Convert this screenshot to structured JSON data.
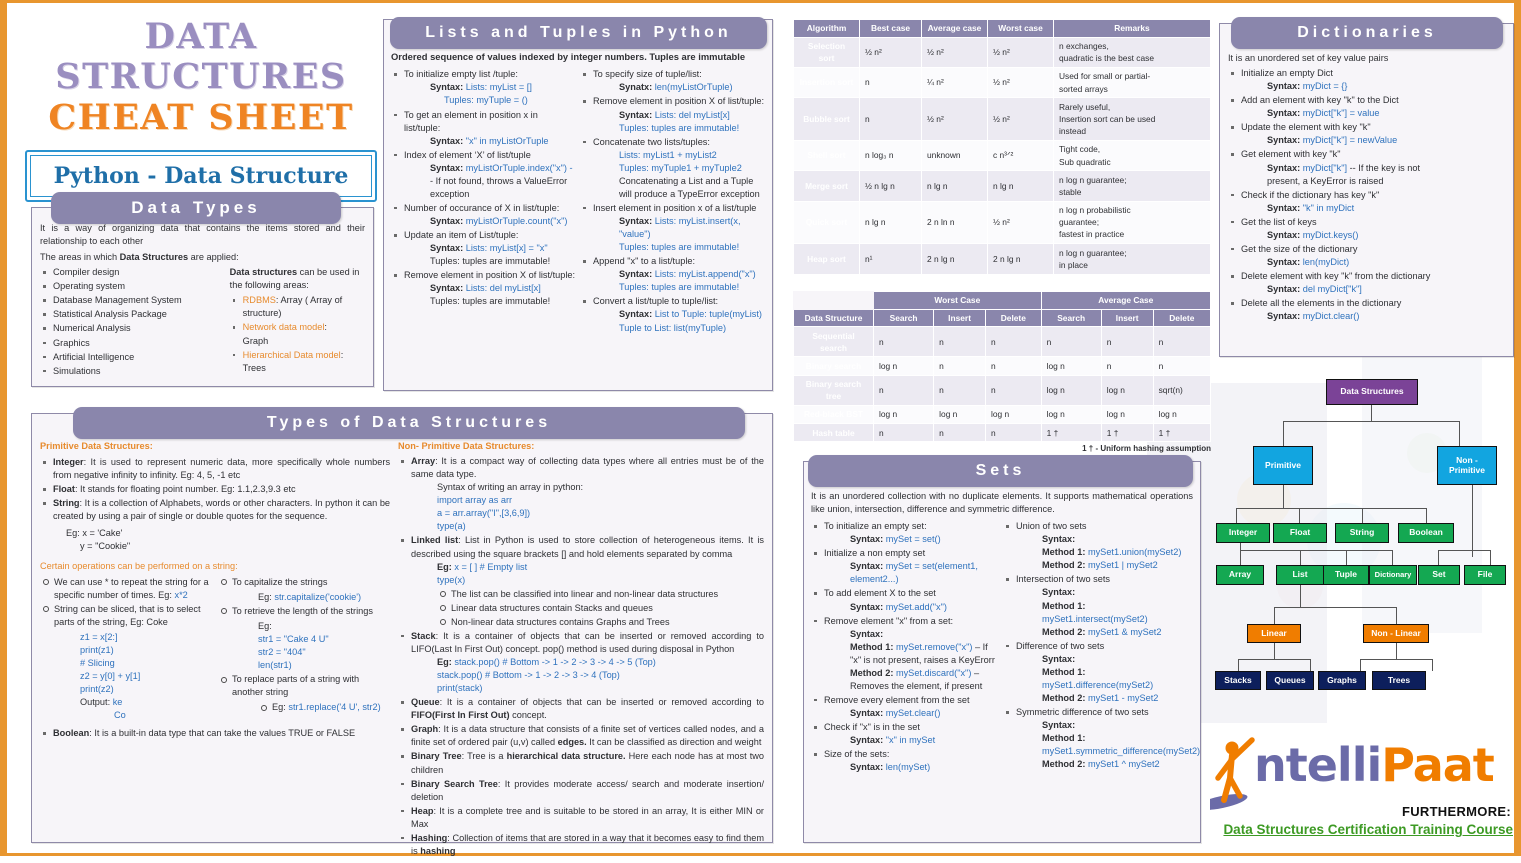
{
  "title": {
    "line1": "DATA STRUCTURES",
    "line2": "CHEAT SHEET",
    "subtitle": "Python - Data Structure"
  },
  "data_types": {
    "heading": "Data Types",
    "intro1": "It is a way of organizing data that contains the items stored and their relationship to each other",
    "intro2_plain": "The areas in which ",
    "intro2_bold": "Data Structures",
    "intro2_tail": " are applied:",
    "areas": [
      "Compiler design",
      "Operating system",
      "Database Management System",
      "Statistical Analysis Package",
      "Numerical Analysis",
      "Graphics",
      "Artificial Intelligence",
      "Simulations"
    ],
    "right_heading_bold": "Data structures",
    "right_heading_tail": " can be used in the following areas:",
    "uses": [
      {
        "label": "RDBMS",
        "text": ": Array ( Array of structure)"
      },
      {
        "label": "Network data model",
        "text": ":",
        "second": "Graph"
      },
      {
        "label": "Hierarchical Data model",
        "text": ":",
        "second": "Trees"
      }
    ]
  },
  "lists_tuples": {
    "heading": "Lists and Tuples in Python",
    "intro": "Ordered sequence of values indexed by integer numbers. Tuples are immutable",
    "left": [
      {
        "t": "To initialize empty list /tuple:",
        "lines": [
          {
            "label": "Syntax: ",
            "code": "Lists: myList = []"
          },
          {
            "label": "",
            "code": "Tuples: myTuple = ()",
            "extraIndent": true
          }
        ]
      },
      {
        "t": "To get an element in position x in list/tuple:",
        "lines": [
          {
            "label": "Syntax: ",
            "code": "\"x\" in myListOrTuple"
          }
        ]
      },
      {
        "t": "Index of element ‘X’ of list/tuple",
        "lines": [
          {
            "label": "Syntax: ",
            "code": "myListOrTuple.index(\"x\") -"
          },
          {
            "label": "",
            "plain": "- If not found, throws a ValueError exception"
          }
        ]
      },
      {
        "t": "Number of occurance of X in list/tuple:",
        "lines": [
          {
            "label": "Syntax: ",
            "code": "myListOrTuple.count(\"x\")"
          }
        ]
      },
      {
        "t": "Update an item of List/tuple:",
        "lines": [
          {
            "label": "Syntax: ",
            "code": "Lists: myList[x] = \"x\""
          },
          {
            "label": "",
            "plain": "Tuples: tuples are immutable!"
          }
        ]
      },
      {
        "t": "Remove element in position X of list/tuple:",
        "lines": [
          {
            "label": "Syntax: ",
            "code": "Lists: del myList[x]"
          },
          {
            "label": "",
            "plain": "Tuples: tuples are immutable!"
          }
        ]
      }
    ],
    "right": [
      {
        "t": "To specify size of tuple/list:",
        "lines": [
          {
            "label": "Synatx: ",
            "code": "len(myListOrTuple)"
          }
        ]
      },
      {
        "t": "Remove element in position X of list/tuple:",
        "lines": [
          {
            "label": "Syntax: ",
            "code": "Lists: del myList[x]"
          },
          {
            "label": "",
            "code": "Tuples: tuples are immutable!"
          }
        ]
      },
      {
        "t": "Concatenate two lists/tuples:",
        "lines": [
          {
            "label": "",
            "code": "Lists: myList1 + myList2"
          },
          {
            "label": "",
            "code": "Tuples: myTuple1 + myTuple2"
          },
          {
            "label": "",
            "plain": "Concatenating a List and a Tuple will produce a TypeError exception"
          }
        ]
      },
      {
        "t": "Insert element in position x of a list/tuple",
        "lines": [
          {
            "label": "Syntax: ",
            "code": "Lists: myList.insert(x, \"value\")"
          },
          {
            "label": "",
            "code": "Tuples: tuples are immutable!"
          }
        ]
      },
      {
        "t": "Append \"x\" to a list/tuple:",
        "lines": [
          {
            "label": "Syntax: ",
            "code": "Lists: myList.append(\"x\")"
          },
          {
            "label": "",
            "code": "Tuples: tuples are immutable!"
          }
        ]
      },
      {
        "t": "Convert a list/tuple to tuple/list:",
        "lines": [
          {
            "label": "Syntax: ",
            "code": "List to Tuple: tuple(myList)"
          },
          {
            "label": "",
            "code": "Tuple to List: list(myTuple)"
          }
        ]
      }
    ]
  },
  "sort_table": {
    "headers": [
      "Algorithm",
      "Best case",
      "Average case",
      "Worst case",
      "Remarks"
    ],
    "rows": [
      {
        "name": "Selection sort",
        "best": "½ n²",
        "avg": "½ n²",
        "worst": "½ n²",
        "remarks": [
          "n exchanges,",
          "quadratic is the best case"
        ]
      },
      {
        "name": "Insertion sort",
        "best": "n",
        "avg": "¼ n²",
        "worst": "½ n²",
        "remarks": [
          "Used for small or partial-",
          "sorted arrays"
        ]
      },
      {
        "name": "Bubble sort",
        "best": "n",
        "avg": "½ n²",
        "worst": "½ n²",
        "remarks": [
          "Rarely useful,",
          "Insertion sort can be used",
          "instead"
        ]
      },
      {
        "name": "Shell sort",
        "best": "n log₃ n",
        "avg": "unknown",
        "worst": "c n³ᐟ²",
        "remarks": [
          "Tight code,",
          "Sub quadratic"
        ]
      },
      {
        "name": "Merge sort",
        "best": "½ n lg n",
        "avg": "n lg n",
        "worst": "n lg n",
        "remarks": [
          "n log n guarantee;",
          "stable"
        ]
      },
      {
        "name": "Quick sort",
        "best": "n lg n",
        "avg": "2 n ln n",
        "worst": "½ n²",
        "remarks": [
          "n log n probabilistic",
          "guarantee;",
          "fastest in practice"
        ]
      },
      {
        "name": "Heap sort",
        "best": "n¹",
        "avg": "2 n lg n",
        "worst": "2 n lg n",
        "remarks": [
          "n log n guarantee;",
          "in place"
        ]
      }
    ]
  },
  "search_table": {
    "group_blank": "",
    "group_worst": "Worst Case",
    "group_average": "Average Case",
    "col_ds": "Data Structure",
    "subheaders": [
      "Search",
      "Insert",
      "Delete",
      "Search",
      "Insert",
      "Delete"
    ],
    "rows": [
      {
        "name": "Sequential search",
        "cells": [
          "n",
          "n",
          "n",
          "n",
          "n",
          "n"
        ]
      },
      {
        "name": "Binary search",
        "cells": [
          "log n",
          "n",
          "n",
          "log n",
          "n",
          "n"
        ]
      },
      {
        "name": "Binary search tree",
        "cells": [
          "n",
          "n",
          "n",
          "log n",
          "log n",
          "sqrt(n)"
        ]
      },
      {
        "name": "Red-black BST",
        "cells": [
          "log n",
          "log n",
          "log n",
          "log n",
          "log n",
          "log n"
        ]
      },
      {
        "name": "Hash table",
        "cells": [
          "n",
          "n",
          "n",
          "1 †",
          "1 †",
          "1 †"
        ]
      }
    ],
    "note": "1 † - Uniform hashing assumption"
  },
  "dictionaries": {
    "heading": "Dictionaries",
    "intro": "It is an unordered set of key value pairs",
    "items": [
      {
        "t": "Initialize an empty Dict",
        "lines": [
          {
            "label": "Syntax: ",
            "code": "myDict = {}"
          }
        ]
      },
      {
        "t": "Add an element with key \"k\" to the Dict",
        "lines": [
          {
            "label": "Syntax: ",
            "code": "myDict[\"k\"] = value"
          }
        ]
      },
      {
        "t": "Update the element with key \"k\"",
        "lines": [
          {
            "label": "Syntax: ",
            "code": "myDict[\"k\"] = newValue"
          }
        ]
      },
      {
        "t": "Get element with key \"k\"",
        "lines": [
          {
            "label": "Syntax: ",
            "code": "myDict[\"k\"]",
            "plainTail": " -- If the key is not"
          },
          {
            "label": "",
            "plain": "present, a KeyError is raised",
            "noIndentExtra": true
          }
        ]
      },
      {
        "t": "Check if the dictionary has key \"k\"",
        "lines": [
          {
            "label": "Syntax: ",
            "code": "\"k\" in myDict"
          }
        ]
      },
      {
        "t": "Get the list of keys",
        "lines": [
          {
            "label": "Syntax: ",
            "code": "myDict.keys()"
          }
        ]
      },
      {
        "t": "Get the size of the dictionary",
        "lines": [
          {
            "label": "Syntax: ",
            "code": "len(myDict)"
          }
        ]
      },
      {
        "t": "Delete element with key \"k\" from the dictionary",
        "lines": [
          {
            "label": "Syntax: ",
            "code": "del myDict[\"k\"]"
          }
        ]
      },
      {
        "t": "Delete all the elements in the dictionary",
        "lines": [
          {
            "label": "Syntax: ",
            "code": "myDict.clear()"
          }
        ]
      }
    ]
  },
  "types_ds": {
    "heading": "Types of Data Structures",
    "primitive_heading": "Primitive Data Structures:",
    "primitive": [
      {
        "label": "Integer",
        "text": ": It is used to represent numeric data, more specifically whole numbers from negative infinity to infinity. Eg: 4, 5, -1 etc"
      },
      {
        "label": "Float",
        "text": ": It stands for floating point number. Eg: 1.1,2.3,9.3 etc"
      },
      {
        "label": "String",
        "text": ": It is a collection of Alphabets, words or other characters. In python it can be created by using a pair of single or double quotes for the sequence."
      }
    ],
    "string_eg": [
      "Eg:  x = 'Cake'",
      "y = \"Cookie\""
    ],
    "ops_heading": "Certain operations can be performed on a string:",
    "ops_left": [
      {
        "t": "We can use * to repeat the string for a specific number of times. Eg: ",
        "code": "x*2"
      },
      {
        "t": "String can be sliced, that is to select parts of the string, Eg: Coke",
        "codeblock": [
          "z1 = x[2:]",
          "print(z1)",
          "# Slicing",
          "z2 = y[0] + y[1]",
          "print(z2)"
        ],
        "output_label": "Output: ",
        "output_code": "ke",
        "output_code2": "Co"
      }
    ],
    "ops_right": [
      {
        "t": "To capitalize the strings",
        "eg_label": "Eg: ",
        "eg_code": "str.capitalize('cookie')"
      },
      {
        "t": "To retrieve the length of the strings",
        "eg_label": "Eg:",
        "codeblock": [
          "str1 = \"Cake 4 U\"",
          "str2 = \"404\"",
          "len(str1)"
        ]
      },
      {
        "t": "To replace parts of a string with another string",
        "sub_eg_label": "Eg: ",
        "sub_eg_code": "str1.replace('4 U', str2)"
      }
    ],
    "boolean": {
      "label": "Boolean",
      "text": ": It is a built-in data type that can take the values TRUE or FALSE"
    },
    "nonprimitive_heading": "Non- Primitive Data Structures:",
    "nonprimitive": [
      {
        "label": "Array",
        "text": ": It is a compact way of collecting data types where all entries must be of the same data type.",
        "sub": [
          "Syntax of writing an array in python:"
        ],
        "codeblock": [
          "import array as arr",
          "a = arr.array(\"I\",[3,6,9])",
          "type(a)"
        ]
      },
      {
        "label": "Linked list",
        "text": ": List in Python is used to store collection of heterogeneous items. It is described using the square brackets [] and hold elements separated by comma",
        "eg_label": "Eg: ",
        "eg_code": "x = [ ] # Empty list",
        "codeblock": [
          "type(x)"
        ],
        "bullets": [
          "The list can be classified into linear and non-linear data structures",
          "Linear data structures contain Stacks and queues",
          "Non-linear data structures contains Graphs and Trees"
        ]
      },
      {
        "label": "Stack",
        "text": ": It is a container of objects that can be inserted or removed according to LIFO(Last In First Out) concept. pop() method is used during disposal in Python",
        "eg_label": "Eg: ",
        "eg_code": "stack.pop() # Bottom -> 1 -> 2 -> 3 -> 4 -> 5 (Top)",
        "codeblock": [
          "stack.pop() # Bottom -> 1 -> 2 -> 3 -> 4 (Top)",
          "print(stack)"
        ]
      },
      {
        "label": "Queue",
        "text": ": It is a container of objects that can be inserted or removed according to ",
        "bold_mid": "FIFO(First In First Out)",
        "tail": " concept."
      },
      {
        "label": "Graph",
        "text": ": It is a data structure that consists of a finite set of vertices called nodes, and a finite set of ordered pair (u,v) called ",
        "bold_mid": "edges.",
        "tail": " It can be classified as direction and weight"
      },
      {
        "label": "Binary Tree",
        "text": ": Tree is a ",
        "bold_mid": "hierarchical data structure.",
        "tail": " Here each node has at most two children"
      },
      {
        "label": "Binary Search Tree",
        "text": ": It provides moderate access/ search and moderate insertion/ deletion"
      },
      {
        "label": "Heap",
        "text": ": It is a complete tree and is suitable to be stored in an array, It is either MIN or Max"
      },
      {
        "label": "Hashing",
        "text": ": Collection of items that are stored in a way that it becomes easy to find them is ",
        "bold_mid": "hashing"
      }
    ]
  },
  "sets": {
    "heading": "Sets",
    "intro": "It is an unordered collection with no duplicate elements. It supports mathematical operations like union, intersection, difference and symmetric difference.",
    "left": [
      {
        "t": "To initialize an empty set:",
        "lines": [
          {
            "label": "Syntax: ",
            "code": "mySet = set()"
          }
        ]
      },
      {
        "t": "Initialize a non empty set",
        "lines": [
          {
            "label": "Syntax:  ",
            "code": "mySet  =  set(element1, element2...)"
          }
        ]
      },
      {
        "t": "To add element X to the set",
        "lines": [
          {
            "label": "Syntax: ",
            "code": "mySet.add(\"x\")"
          }
        ]
      },
      {
        "t": "Remove element \"x\" from a set:",
        "lines": [
          {
            "label": "Syntax:",
            "plain": ""
          },
          {
            "label": "Method 1: ",
            "code": "mySet.remove(\"x\")",
            "plainTail": " – If \"x\" is not present, raises a KeyErorr"
          },
          {
            "label": "Method 2: ",
            "code": "mySet.discard(\"x\")",
            "plainTail": " – Removes the element, if present"
          }
        ]
      },
      {
        "t": "Remove every element from the set",
        "lines": [
          {
            "label": "Syntax: ",
            "code": "mySet.clear()"
          }
        ]
      },
      {
        "t": "Check if \"x\" is in the set",
        "lines": [
          {
            "label": "Syntax: ",
            "code": "\"x\" in mySet"
          }
        ]
      },
      {
        "t": "Size of the sets:",
        "lines": [
          {
            "label": "Syntax: ",
            "code": "len(mySet)"
          }
        ]
      }
    ],
    "right": [
      {
        "t": "Union of two sets",
        "lines": [
          {
            "label": "Syntax:",
            "plain": ""
          },
          {
            "label": "Method 1: ",
            "code": "mySet1.union(mySet2)"
          },
          {
            "label": "Method 2: ",
            "code": "mySet1 | mySet2"
          }
        ]
      },
      {
        "t": "Intersection of two sets",
        "lines": [
          {
            "label": "Syntax:",
            "plain": ""
          },
          {
            "label": "Method 1:",
            "plain": ""
          },
          {
            "label": "",
            "code": "mySet1.intersect(mySet2)"
          },
          {
            "label": "Method 2: ",
            "code": "mySet1 & mySet2"
          }
        ]
      },
      {
        "t": "Difference of two sets",
        "lines": [
          {
            "label": "Syntax:",
            "plain": ""
          },
          {
            "label": "Method 1:",
            "plain": ""
          },
          {
            "label": "",
            "code": "mySet1.difference(mySet2)"
          },
          {
            "label": "Method 2: ",
            "code": "mySet1 - mySet2"
          }
        ]
      },
      {
        "t": "Symmetric difference of two sets",
        "lines": [
          {
            "label": "Syntax:",
            "plain": ""
          },
          {
            "label": "Method 1:",
            "plain": ""
          },
          {
            "label": "",
            "code": "mySet1.symmetric_difference(mySet2)"
          },
          {
            "label": "Method 2: ",
            "code": "mySet1 ^ mySet2"
          }
        ]
      }
    ]
  },
  "tree_diagram": {
    "root": "Data Structures",
    "level1": [
      "Primitive",
      "Non - Primitive"
    ],
    "level2": [
      "Integer",
      "Float",
      "String",
      "Boolean"
    ],
    "level3": [
      "Array",
      "List",
      "Tuple",
      "Dictionary",
      "Set",
      "File"
    ],
    "level4": [
      "Linear",
      "Non - Linear"
    ],
    "level5": [
      "Stacks",
      "Queues",
      "Graphs",
      "Trees"
    ]
  },
  "footer": {
    "logo_part1": "ntelli",
    "logo_part2": "Paat",
    "furthermore": "FURTHERMORE:",
    "course": "Data Structures Certification Training Course"
  },
  "colors": {
    "accent_orange": "#e8962f",
    "header_purple": "#8a86ac",
    "title_purple": "#9a8ec0",
    "code_blue": "#2f72bd",
    "green": "#14a852"
  }
}
